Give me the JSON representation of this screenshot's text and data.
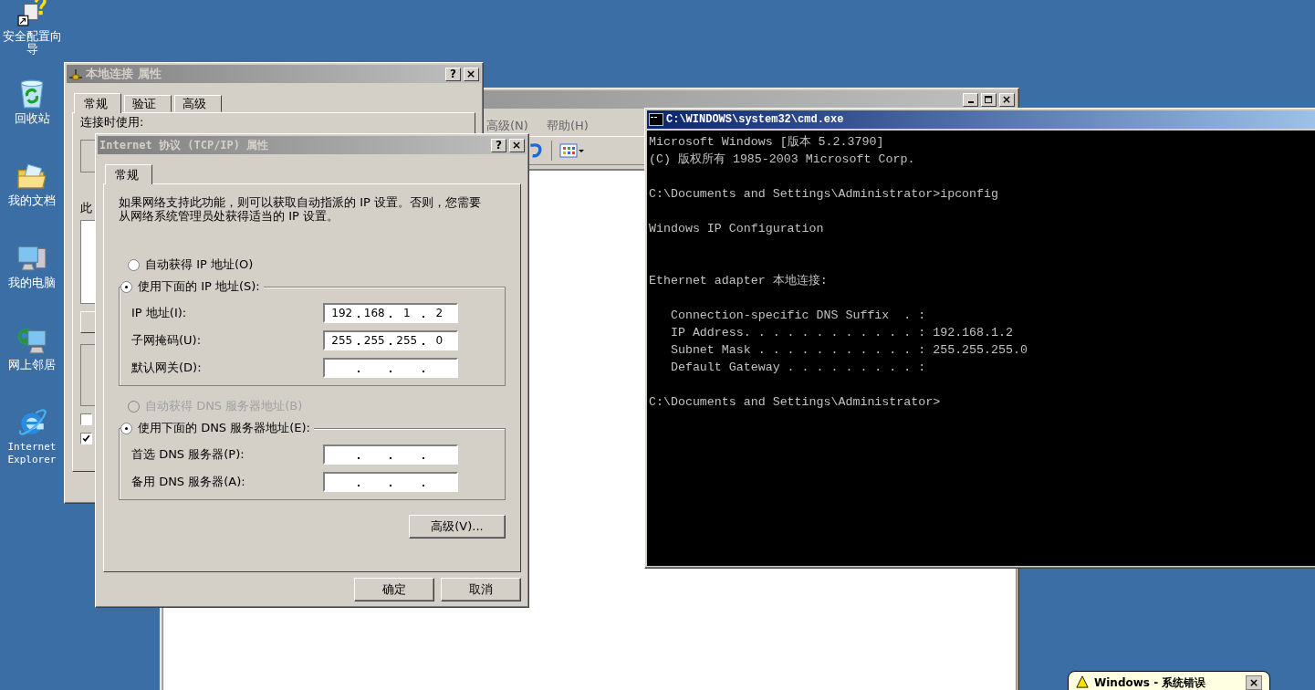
{
  "desktop_icons": [
    {
      "label": "安全配置向导",
      "kind": "wizard"
    },
    {
      "label": "回收站",
      "kind": "recycle"
    },
    {
      "label": "我的文档",
      "kind": "documents"
    },
    {
      "label": "我的电脑",
      "kind": "computer"
    },
    {
      "label": "网上邻居",
      "kind": "network"
    },
    {
      "label": "Internet Explorer",
      "kind": "browser"
    }
  ],
  "background_window": {
    "menu": [
      "高级(N)",
      "帮助(H)"
    ]
  },
  "local_connection_dialog": {
    "title": "本地连接 属性",
    "help_button": "?",
    "tabs": [
      {
        "label": "常规",
        "selected": true
      },
      {
        "label": "验证",
        "selected": false
      },
      {
        "label": "高级",
        "selected": false
      }
    ],
    "connect_label": "连接时使用:",
    "items_label": "此",
    "checkboxes": [
      {
        "checked": false
      },
      {
        "checked": true
      }
    ]
  },
  "tcpip_dialog": {
    "title": "Internet 协议 (TCP/IP) 属性",
    "help_button": "?",
    "tabs": [
      {
        "label": "常规",
        "selected": true
      }
    ],
    "description": "如果网络支持此功能，则可以获取自动指派的 IP 设置。否则，您需要从网络系统管理员处获得适当的 IP 设置。",
    "sections": [
      {
        "auto_option": {
          "label": "自动获得 IP 地址(O)",
          "selected": false,
          "disabled": false
        },
        "manual_option": {
          "label": "使用下面的 IP 地址(S):",
          "selected": true,
          "disabled": false
        },
        "fields": [
          {
            "label": "IP 地址(I):",
            "octets": [
              "192",
              "168",
              "1",
              "2"
            ]
          },
          {
            "label": "子网掩码(U):",
            "octets": [
              "255",
              "255",
              "255",
              "0"
            ]
          },
          {
            "label": "默认网关(D):"
          }
        ]
      },
      {
        "auto_option": {
          "label": "自动获得 DNS 服务器地址(B)",
          "selected": false,
          "disabled": true
        },
        "manual_option": {
          "label": "使用下面的 DNS 服务器地址(E):",
          "selected": true,
          "disabled": false
        },
        "fields": [
          {
            "label": "首选 DNS 服务器(P):"
          },
          {
            "label": "备用 DNS 服务器(A):"
          }
        ]
      }
    ],
    "advanced_button": "高级(V)...",
    "buttons": [
      "确定",
      "取消"
    ]
  },
  "cmd_window": {
    "title": "C:\\WINDOWS\\system32\\cmd.exe",
    "output": "Microsoft Windows [版本 5.2.3790]\n(C) 版权所有 1985-2003 Microsoft Corp.\n\nC:\\Documents and Settings\\Administrator>ipconfig\n\nWindows IP Configuration\n\n\nEthernet adapter 本地连接:\n\n   Connection-specific DNS Suffix  . :\n   IP Address. . . . . . . . . . . . : 192.168.1.2\n   Subnet Mask . . . . . . . . . . . : 255.255.255.0\n   Default Gateway . . . . . . . . . :\n\nC:\\Documents and Settings\\Administrator>"
  },
  "notification": {
    "title": "Windows - 系统错误"
  }
}
